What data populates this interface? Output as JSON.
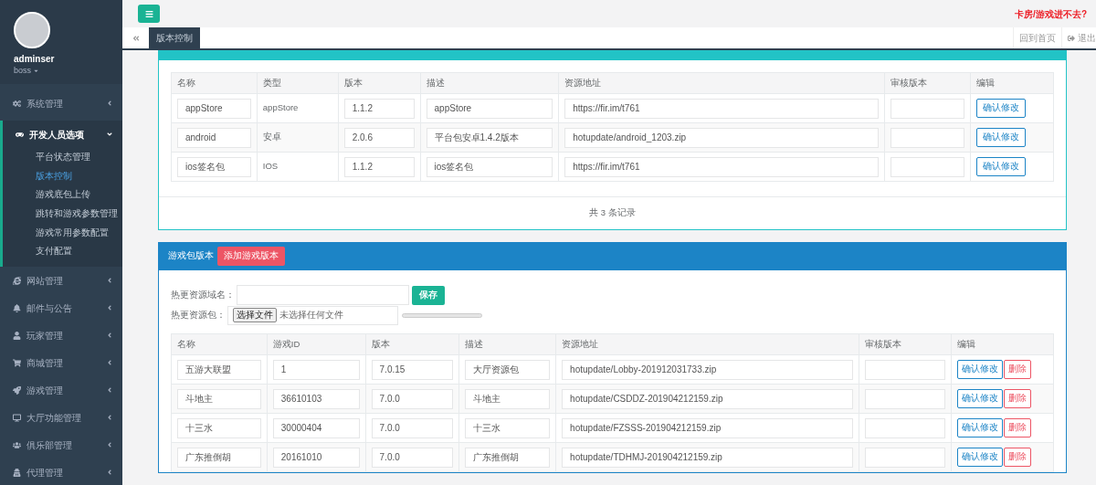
{
  "sidebar": {
    "user": {
      "name": "adminser",
      "role": "boss"
    },
    "menu": [
      {
        "label": "系统管理",
        "expanded": false
      },
      {
        "label": "开发人员选项",
        "expanded": true,
        "children": [
          {
            "label": "平台状态管理",
            "selected": false
          },
          {
            "label": "版本控制",
            "selected": true
          },
          {
            "label": "游戏底包上传",
            "selected": false
          },
          {
            "label": "跳转和游戏参数管理",
            "selected": false
          },
          {
            "label": "游戏常用参数配置",
            "selected": false
          },
          {
            "label": "支付配置",
            "selected": false
          }
        ]
      },
      {
        "label": "网站管理",
        "expanded": false
      },
      {
        "label": "邮件与公告",
        "expanded": false
      },
      {
        "label": "玩家管理",
        "expanded": false
      },
      {
        "label": "商城管理",
        "expanded": false
      },
      {
        "label": "游戏管理",
        "expanded": false
      },
      {
        "label": "大厅功能管理",
        "expanded": false
      },
      {
        "label": "俱乐部管理",
        "expanded": false
      },
      {
        "label": "代理管理",
        "expanded": false
      }
    ]
  },
  "top_bar": {
    "notice": "卡房/游戏进不去?"
  },
  "tab_bar": {
    "tabs": [
      {
        "label": "版本控制",
        "selected": true
      }
    ],
    "home_link": "回到首页",
    "logout_link": "退出"
  },
  "platform_panel": {
    "table": {
      "columns": [
        "名称",
        "类型",
        "版本",
        "描述",
        "资源地址",
        "审核版本",
        "编辑"
      ],
      "rows": [
        {
          "name": "appStore",
          "type": "appStore",
          "version": "1.1.2",
          "description": "appStore",
          "url": "https://fir.im/t761",
          "review_version": "",
          "action": "确认修改"
        },
        {
          "name": "android",
          "type": "安卓",
          "version": "2.0.6",
          "description": "平台包安卓1.4.2版本",
          "url": "hotupdate/android_1203.zip",
          "review_version": "",
          "action": "确认修改"
        },
        {
          "name": "ios签名包",
          "type": "IOS",
          "version": "1.1.2",
          "description": "ios签名包",
          "url": "https://fir.im/t761",
          "review_version": "",
          "action": "确认修改"
        }
      ]
    },
    "footer": "共 3 条记录"
  },
  "game_panel": {
    "title": "游戏包版本",
    "add_button": "添加游戏版本",
    "domain_label": "热更资源域名：",
    "save_button": "保存",
    "package_label": "热更资源包：",
    "file_button": "选择文件",
    "file_status": "未选择任何文件",
    "upload_progress": {
      "level": 0
    },
    "table": {
      "columns": [
        "名称",
        "游戏ID",
        "版本",
        "描述",
        "资源地址",
        "审核版本",
        "编辑"
      ],
      "rows": [
        {
          "name": "五游大联盟",
          "game_id": "1",
          "version": "7.0.15",
          "description": "大厅资源包",
          "url": "hotupdate/Lobby-201912031733.zip",
          "confirm": "确认修改",
          "delete": "删除"
        },
        {
          "name": "斗地主",
          "game_id": "36610103",
          "version": "7.0.0",
          "description": "斗地主",
          "url": "hotupdate/CSDDZ-201904212159.zip",
          "confirm": "确认修改",
          "delete": "删除"
        },
        {
          "name": "十三水",
          "game_id": "30000404",
          "version": "7.0.0",
          "description": "十三水",
          "url": "hotupdate/FZSSS-201904212159.zip",
          "confirm": "确认修改",
          "delete": "删除"
        },
        {
          "name": "广东推倒胡",
          "game_id": "20161010",
          "version": "7.0.0",
          "description": "广东推倒胡",
          "url": "hotupdate/TDHMJ-201904212159.zip",
          "confirm": "确认修改",
          "delete": "删除"
        }
      ]
    }
  }
}
